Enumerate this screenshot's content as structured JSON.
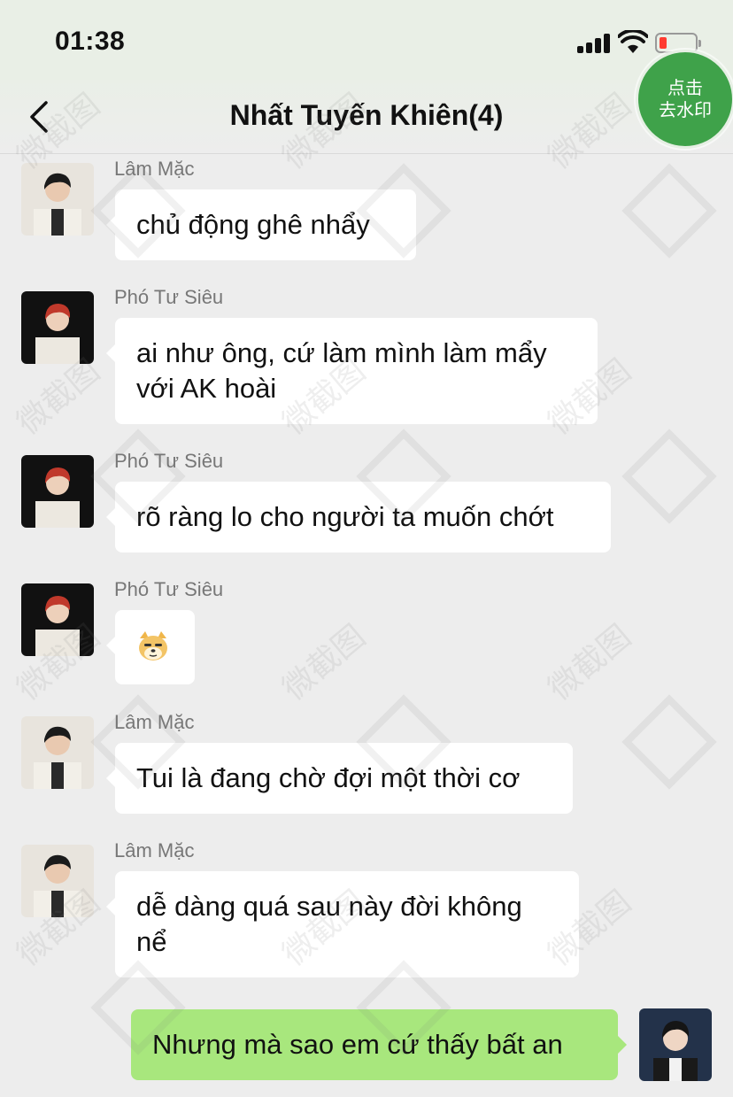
{
  "status": {
    "time": "01:38"
  },
  "nav": {
    "title": "Nhất Tuyến Khiên(4)",
    "watermark_line1": "点击",
    "watermark_line2": "去水印"
  },
  "watermark_text": "微截图",
  "messages": [
    {
      "sender": "Lâm Mặc",
      "text": "chủ động ghê nhẩy"
    },
    {
      "sender": "Phó Tư Siêu",
      "line1": "ai như ông, cứ làm mình làm mẩy",
      "line2": "với AK hoài"
    },
    {
      "sender": "Phó Tư Siêu",
      "text": "rõ ràng lo cho người ta muốn chớt"
    },
    {
      "sender": "Phó Tư Siêu",
      "sticker": "doge-cat-sticker"
    },
    {
      "sender": "Lâm Mặc",
      "text": "Tui là đang chờ đợi một thời cơ"
    },
    {
      "sender": "Lâm Mặc",
      "line1": "dễ dàng quá sau này đời không",
      "line2": "nể"
    },
    {
      "self": true,
      "text": "Nhưng mà sao em cứ thấy bất an"
    }
  ],
  "colors": {
    "background": "#ededed",
    "self_bubble": "#a8e77d",
    "other_bubble": "#ffffff",
    "watermark_button": "#3fa24a",
    "battery_low": "#ff3b30"
  }
}
